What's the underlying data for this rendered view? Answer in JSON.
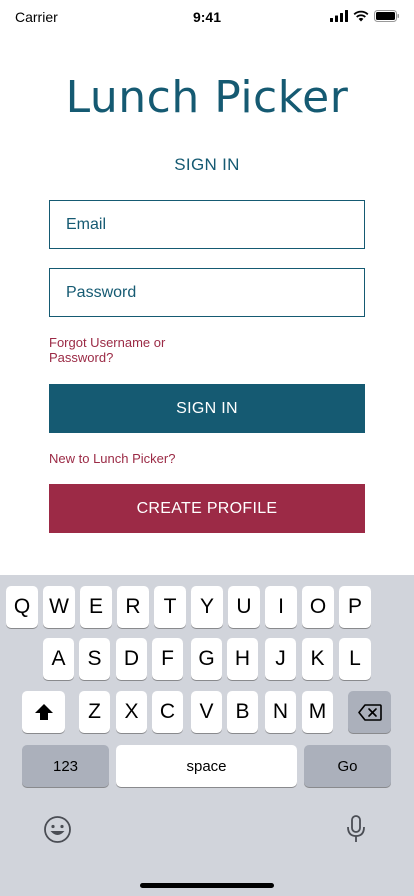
{
  "status_bar": {
    "carrier": "Carrier",
    "time": "9:41"
  },
  "app": {
    "title": "Lunch Picker",
    "form_heading": "SIGN IN"
  },
  "form": {
    "email_placeholder": "Email",
    "password_placeholder": "Password",
    "forgot_link": "Forgot Username or Password?",
    "signin_label": "SIGN IN",
    "new_user_prompt": "New to Lunch Picker?",
    "create_label": "CREATE PROFILE"
  },
  "keyboard": {
    "row1": [
      "Q",
      "W",
      "E",
      "R",
      "T",
      "Y",
      "U",
      "I",
      "O",
      "P"
    ],
    "row2": [
      "A",
      "S",
      "D",
      "F",
      "G",
      "H",
      "J",
      "K",
      "L"
    ],
    "row3": [
      "Z",
      "X",
      "C",
      "V",
      "B",
      "N",
      "M"
    ],
    "numbers_label": "123",
    "space_label": "space",
    "go_label": "Go",
    "icons": {
      "shift": "shift-icon",
      "delete": "backspace-icon",
      "emoji": "emoji-icon",
      "dictation": "microphone-icon"
    }
  },
  "colors": {
    "primary": "#155a72",
    "accent": "#9c2a46",
    "keyboard_bg": "#d1d4db"
  }
}
